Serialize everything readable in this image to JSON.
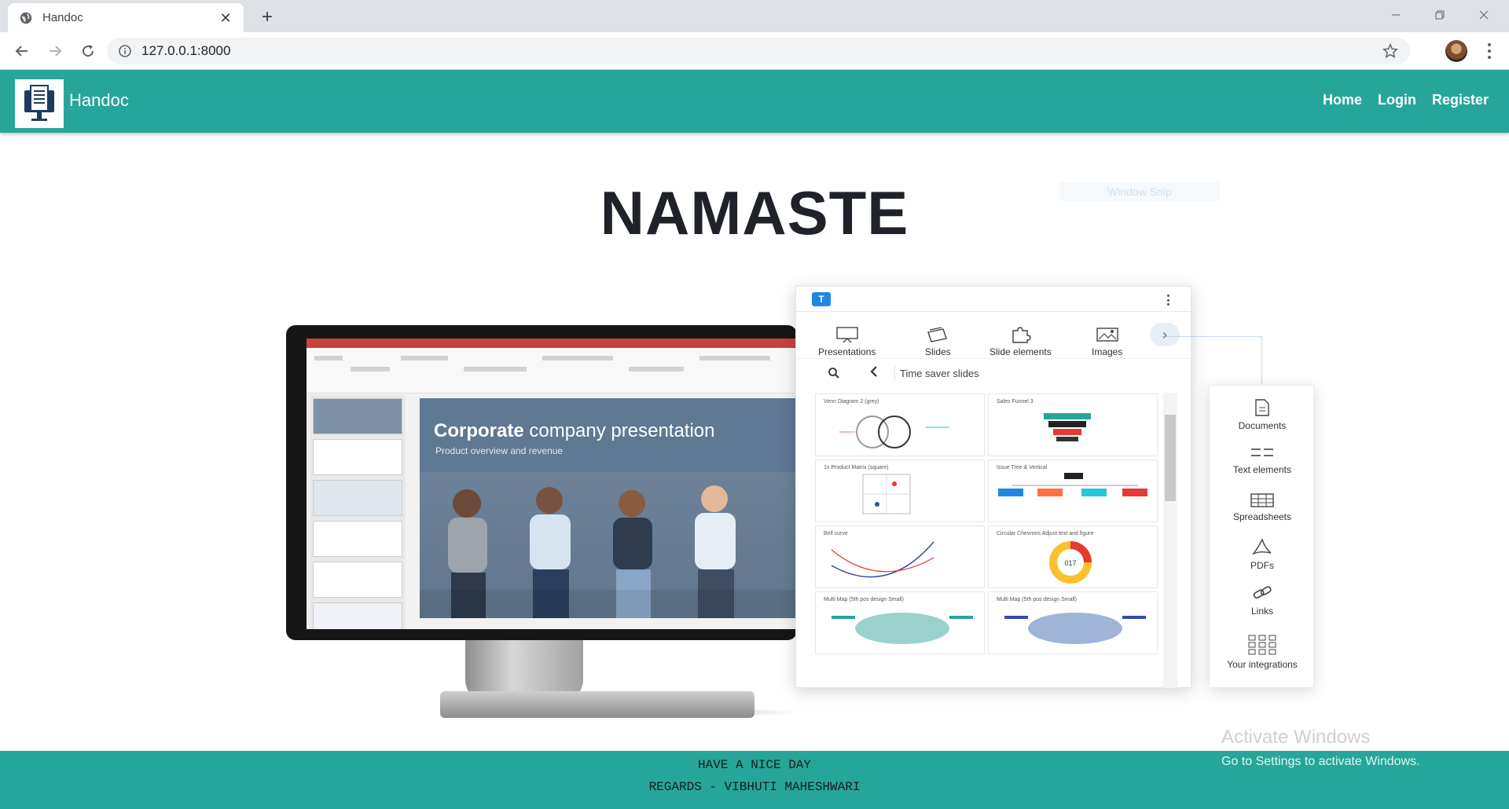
{
  "browser": {
    "tab_title": "Handoc",
    "url": "127.0.0.1:8000",
    "tab_close_glyph": "✕",
    "new_tab_glyph": "+"
  },
  "site": {
    "brand": "Handoc",
    "nav": [
      {
        "label": "Home"
      },
      {
        "label": "Login"
      },
      {
        "label": "Register"
      }
    ],
    "heading": "NAMASTE",
    "snip_label": "Window Snip"
  },
  "hero": {
    "slide_title_bold": "Corporate",
    "slide_title_rest": " company presentation",
    "slide_subtitle": "Product overview and revenue",
    "panel": {
      "logo_letter": "T",
      "categories": [
        "Presentations",
        "Slides",
        "Slide elements",
        "Images"
      ],
      "search_text": "Time saver slides",
      "cards": [
        "Venn Diagram 2 (grey)",
        "Sales Funnel 3",
        "1x Product Matrix (square)",
        "Issue Tree & Vertical",
        "Bell curve",
        "Circular Chevrons Adjust text and figure",
        "Multi Map (5th pos design Small)",
        "Multi Map (5th pos design Small)"
      ],
      "donut_value": "017"
    },
    "side_items": [
      "Documents",
      "Text elements",
      "Spreadsheets",
      "PDFs",
      "Links",
      "Your integrations"
    ]
  },
  "footer": {
    "line1": "HAVE A NICE DAY",
    "line2": "REGARDS - VIBHUTI MAHESHWARI"
  },
  "watermark": {
    "title": "Activate Windows",
    "subtitle": "Go to Settings to activate Windows."
  },
  "colors": {
    "brand_teal": "#26a69a",
    "heading": "#1f2329"
  }
}
